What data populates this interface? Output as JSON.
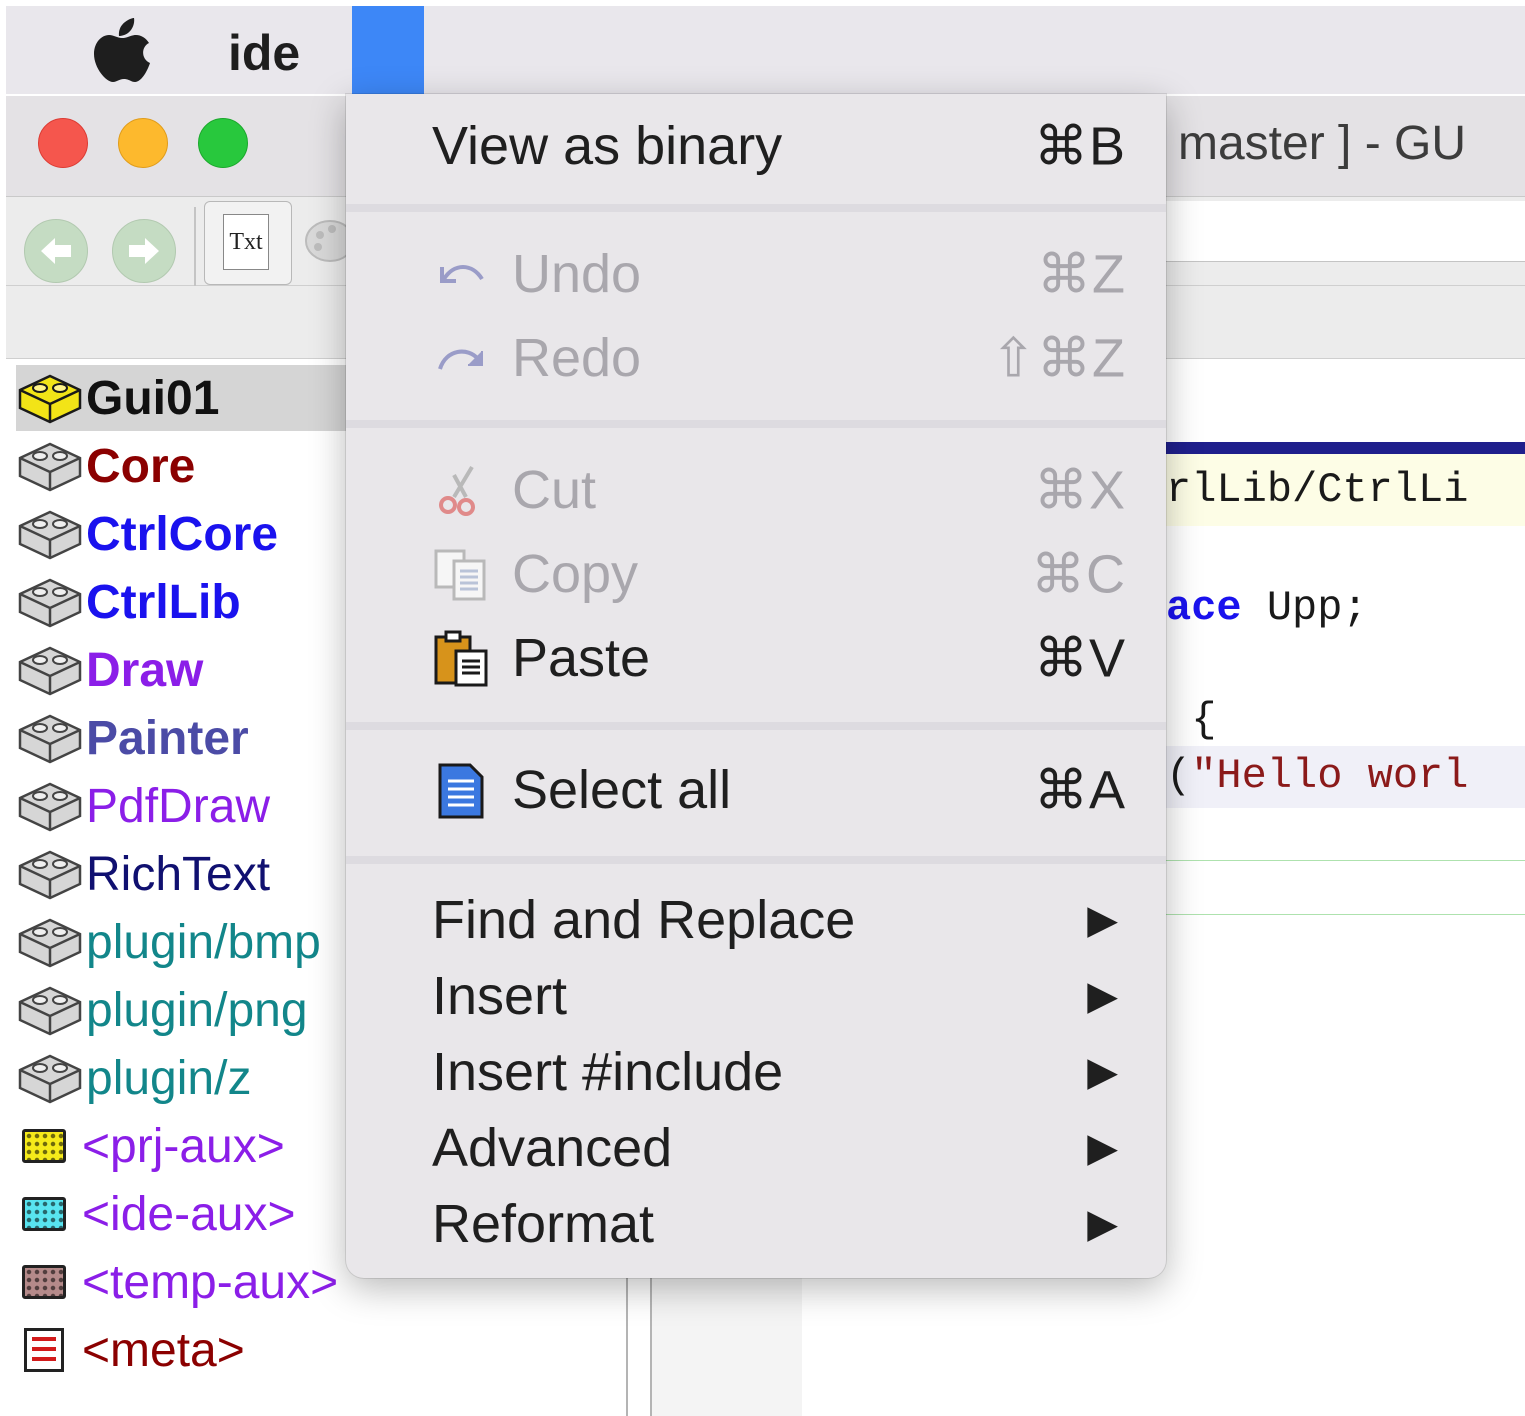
{
  "menubar": {
    "app_name": "ide"
  },
  "window": {
    "title": "master ]  - GU"
  },
  "packages": [
    {
      "label": "Gui01",
      "color": "#111111",
      "bold": true,
      "icon": "yellow-package-icon"
    },
    {
      "label": "Core",
      "color": "#8b0000",
      "bold": true,
      "icon": "gray-package-icon"
    },
    {
      "label": "CtrlCore",
      "color": "#1a12ee",
      "bold": true,
      "icon": "gray-package-icon"
    },
    {
      "label": "CtrlLib",
      "color": "#1a12ee",
      "bold": true,
      "icon": "gray-package-icon"
    },
    {
      "label": "Draw",
      "color": "#8b1ee8",
      "bold": true,
      "icon": "gray-package-icon"
    },
    {
      "label": "Painter",
      "color": "#4b4ba6",
      "bold": true,
      "icon": "gray-package-icon"
    },
    {
      "label": "PdfDraw",
      "color": "#8b1ee8",
      "bold": false,
      "icon": "gray-package-icon"
    },
    {
      "label": "RichText",
      "color": "#101070",
      "bold": false,
      "icon": "gray-package-icon"
    },
    {
      "label": "plugin/bmp",
      "color": "#12868a",
      "bold": false,
      "icon": "gray-package-icon"
    },
    {
      "label": "plugin/png",
      "color": "#12868a",
      "bold": false,
      "icon": "gray-package-icon"
    },
    {
      "label": "plugin/z",
      "color": "#12868a",
      "bold": false,
      "icon": "gray-package-icon"
    },
    {
      "label": "<prj-aux>",
      "color": "#8b1ee8",
      "bold": false,
      "icon": "yellow-aux-icon"
    },
    {
      "label": "<ide-aux>",
      "color": "#8b1ee8",
      "bold": false,
      "icon": "cyan-aux-icon"
    },
    {
      "label": "<temp-aux>",
      "color": "#8b1ee8",
      "bold": false,
      "icon": "brown-aux-icon"
    },
    {
      "label": "<meta>",
      "color": "#8b0000",
      "bold": false,
      "icon": "meta-list-icon"
    }
  ],
  "code": {
    "header": "rlLib/CtrlLi",
    "line1_kw": "ace",
    "line1_rest": " Upp;",
    "line2": " {",
    "line3_paren": "(",
    "line3_str": "\"Hello worl"
  },
  "menu": {
    "view_binary": {
      "label": "View as binary",
      "shortcut": "⌘B"
    },
    "undo": {
      "label": "Undo",
      "shortcut": "⌘Z"
    },
    "redo": {
      "label": "Redo",
      "shortcut": "⇧⌘Z"
    },
    "cut": {
      "label": "Cut",
      "shortcut": "⌘X"
    },
    "copy": {
      "label": "Copy",
      "shortcut": "⌘C"
    },
    "paste": {
      "label": "Paste",
      "shortcut": "⌘V"
    },
    "select_all": {
      "label": "Select all",
      "shortcut": "⌘A"
    },
    "submenus": [
      "Find and Replace",
      "Insert",
      "Insert #include",
      "Advanced",
      "Reformat"
    ],
    "submenu_arrow": "▶"
  },
  "colors": {
    "menu_bg": "#e9e7ea",
    "highlight_blue": "#3d87f7",
    "disabled_text": "#a9a7ad",
    "keyword_blue": "#1a12ee",
    "string_red": "#8b1a1a"
  }
}
